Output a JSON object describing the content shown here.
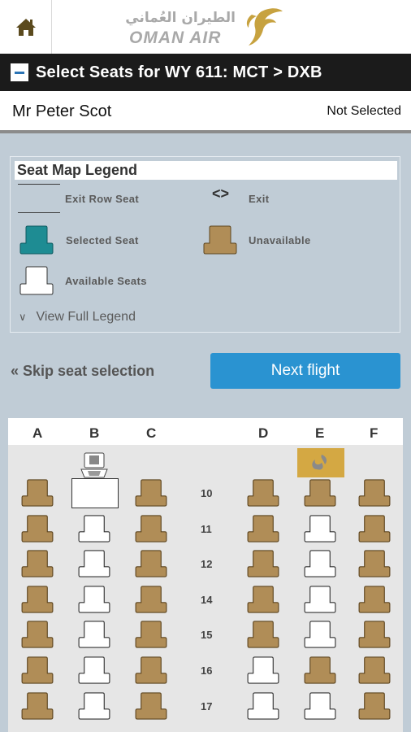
{
  "header": {
    "home_icon": "home-icon",
    "logo_arabic": "الطيران العُماني",
    "logo_text": "OMAN AIR"
  },
  "flight": {
    "title": "Select Seats for WY 611: MCT > DXB"
  },
  "passenger": {
    "name": "Mr Peter Scot",
    "status": "Not Selected"
  },
  "legend": {
    "title": "Seat Map Legend",
    "exit_row": "Exit Row Seat",
    "exit": "Exit",
    "selected": "Selected Seat",
    "unavailable": "Unavailable",
    "available": "Available Seats",
    "view_full": "View Full Legend"
  },
  "actions": {
    "skip": "Skip seat selection",
    "next": "Next flight"
  },
  "seatmap": {
    "columns": [
      "A",
      "B",
      "C",
      "D",
      "E",
      "F"
    ],
    "rows": [
      {
        "num": "10",
        "seats": [
          "unavailable",
          "blank",
          "unavailable",
          "unavailable",
          "unavailable",
          "unavailable"
        ]
      },
      {
        "num": "11",
        "seats": [
          "unavailable",
          "available",
          "unavailable",
          "unavailable",
          "available",
          "unavailable"
        ]
      },
      {
        "num": "12",
        "seats": [
          "unavailable",
          "available",
          "unavailable",
          "unavailable",
          "available",
          "unavailable"
        ]
      },
      {
        "num": "14",
        "seats": [
          "unavailable",
          "available",
          "unavailable",
          "unavailable",
          "available",
          "unavailable"
        ]
      },
      {
        "num": "15",
        "seats": [
          "unavailable",
          "available",
          "unavailable",
          "unavailable",
          "available",
          "unavailable"
        ]
      },
      {
        "num": "16",
        "seats": [
          "unavailable",
          "available",
          "unavailable",
          "available",
          "unavailable",
          "unavailable"
        ]
      },
      {
        "num": "17",
        "seats": [
          "unavailable",
          "available",
          "unavailable",
          "available",
          "available",
          "unavailable"
        ]
      }
    ],
    "facilities": [
      {
        "column": "B",
        "type": "lavatory",
        "icon": "lavatory-icon"
      },
      {
        "column": "E",
        "type": "galley",
        "icon": "galley-icon"
      }
    ]
  },
  "colors": {
    "unavailable_fill": "#b08d57",
    "selected_fill": "#1e8c93",
    "available_fill": "#ffffff",
    "button_blue": "#2a93d1",
    "header_black": "#1b1b1b"
  }
}
